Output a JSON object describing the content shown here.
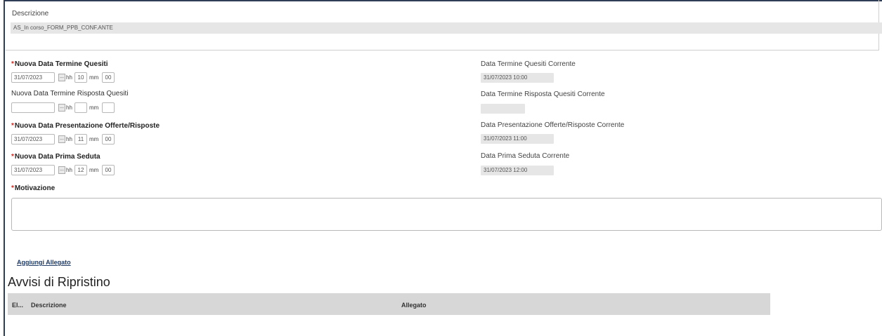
{
  "descrizione": {
    "label": "Descrizione",
    "value": "AS_In corso_FORM_PPB_CONF.ANTE"
  },
  "fields": {
    "termine_quesiti": {
      "required_mark": "*",
      "label": "Nuova Data Termine Quesiti",
      "date": "31/07/2023",
      "hh_label": "hh",
      "hh": "10",
      "mm_label": "mm",
      "mm": "00",
      "date_button": "..."
    },
    "termine_risposta": {
      "label": "Nuova Data Termine Risposta Quesiti",
      "date": "",
      "hh_label": "hh",
      "hh": "",
      "mm_label": "mm",
      "mm": "",
      "date_button": "..."
    },
    "presentazione": {
      "required_mark": "*",
      "label": "Nuova Data Presentazione Offerte/Risposte",
      "date": "31/07/2023",
      "hh_label": "hh",
      "hh": "11",
      "mm_label": "mm",
      "mm": "00",
      "date_button": "..."
    },
    "prima_seduta": {
      "required_mark": "*",
      "label": "Nuova Data Prima Seduta",
      "date": "31/07/2023",
      "hh_label": "hh",
      "hh": "12",
      "mm_label": "mm",
      "mm": "00",
      "date_button": "..."
    },
    "motivazione": {
      "required_mark": "*",
      "label": "Motivazione",
      "value": ""
    }
  },
  "current": {
    "termine_quesiti": {
      "label": "Data Termine Quesiti Corrente",
      "value": "31/07/2023 10:00"
    },
    "termine_risposta": {
      "label": "Data Termine Risposta Quesiti Corrente",
      "value": ""
    },
    "presentazione": {
      "label": "Data Presentazione Offerte/Risposte Corrente",
      "value": "31/07/2023 11:00"
    },
    "prima_seduta": {
      "label": "Data Prima Seduta Corrente",
      "value": "31/07/2023 12:00"
    }
  },
  "attachments": {
    "add_link": "Aggiungi Allegato"
  },
  "avvisi": {
    "title": "Avvisi di Ripristino",
    "columns": [
      "El...",
      "Descrizione",
      "Allegato"
    ]
  }
}
